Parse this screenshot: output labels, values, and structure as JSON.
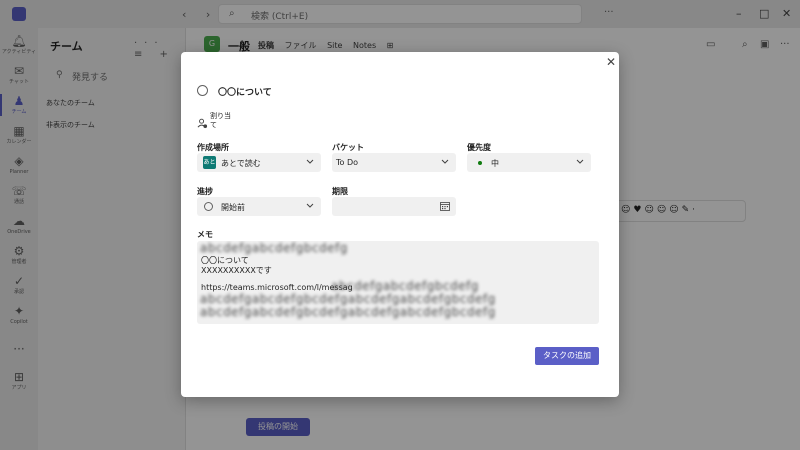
{
  "background": {
    "search_placeholder": "検索 (Ctrl+E)",
    "rail": [
      {
        "icon": "bell-icon",
        "label": "アクティビティ"
      },
      {
        "icon": "chat-icon",
        "label": "チャット"
      },
      {
        "icon": "teams-icon",
        "label": "チーム"
      },
      {
        "icon": "calendar-icon",
        "label": "カレンダー"
      },
      {
        "icon": "planner-icon",
        "label": "Planner"
      },
      {
        "icon": "phone-icon",
        "label": "通話"
      },
      {
        "icon": "onedrive-icon",
        "label": "OneDrive"
      },
      {
        "icon": "admin-icon",
        "label": "管理者"
      },
      {
        "icon": "vivaengage-icon",
        "label": "承認"
      },
      {
        "icon": "copilot-icon",
        "label": "Copilot"
      },
      {
        "icon": "more-icon",
        "label": ""
      },
      {
        "icon": "apps-icon",
        "label": "アプリ"
      }
    ],
    "panel_title": "チーム",
    "panel_search": "発見する",
    "teams": [
      "あなたのチーム",
      "非表示のチーム"
    ],
    "channel_name": "一般",
    "tabs": [
      "投稿",
      "ファイル",
      "Site",
      "Notes"
    ],
    "post_button": "投稿の開始"
  },
  "dialog": {
    "task_title": "〇〇について",
    "assign_label": "割り当て",
    "location": {
      "label": "作成場所",
      "badge": "あと",
      "value": "あとで読む"
    },
    "bucket": {
      "label": "バケット",
      "value": "To Do"
    },
    "priority": {
      "label": "優先度",
      "value": "中"
    },
    "progress": {
      "label": "進捗",
      "value": "開始前"
    },
    "due": {
      "label": "期限",
      "value": ""
    },
    "memo": {
      "label": "メモ",
      "line1": "〇〇について",
      "line2": "XXXXXXXXXXです",
      "url": "https://teams.microsoft.com/l/messag",
      "blurred_text": "abcdefgabcdefgbcdefg"
    },
    "add_button": "タスクの追加"
  },
  "colors": {
    "accent": "#5b5fc7",
    "plan_badge": "#0e7a74",
    "priority_dot": "#107c10"
  }
}
